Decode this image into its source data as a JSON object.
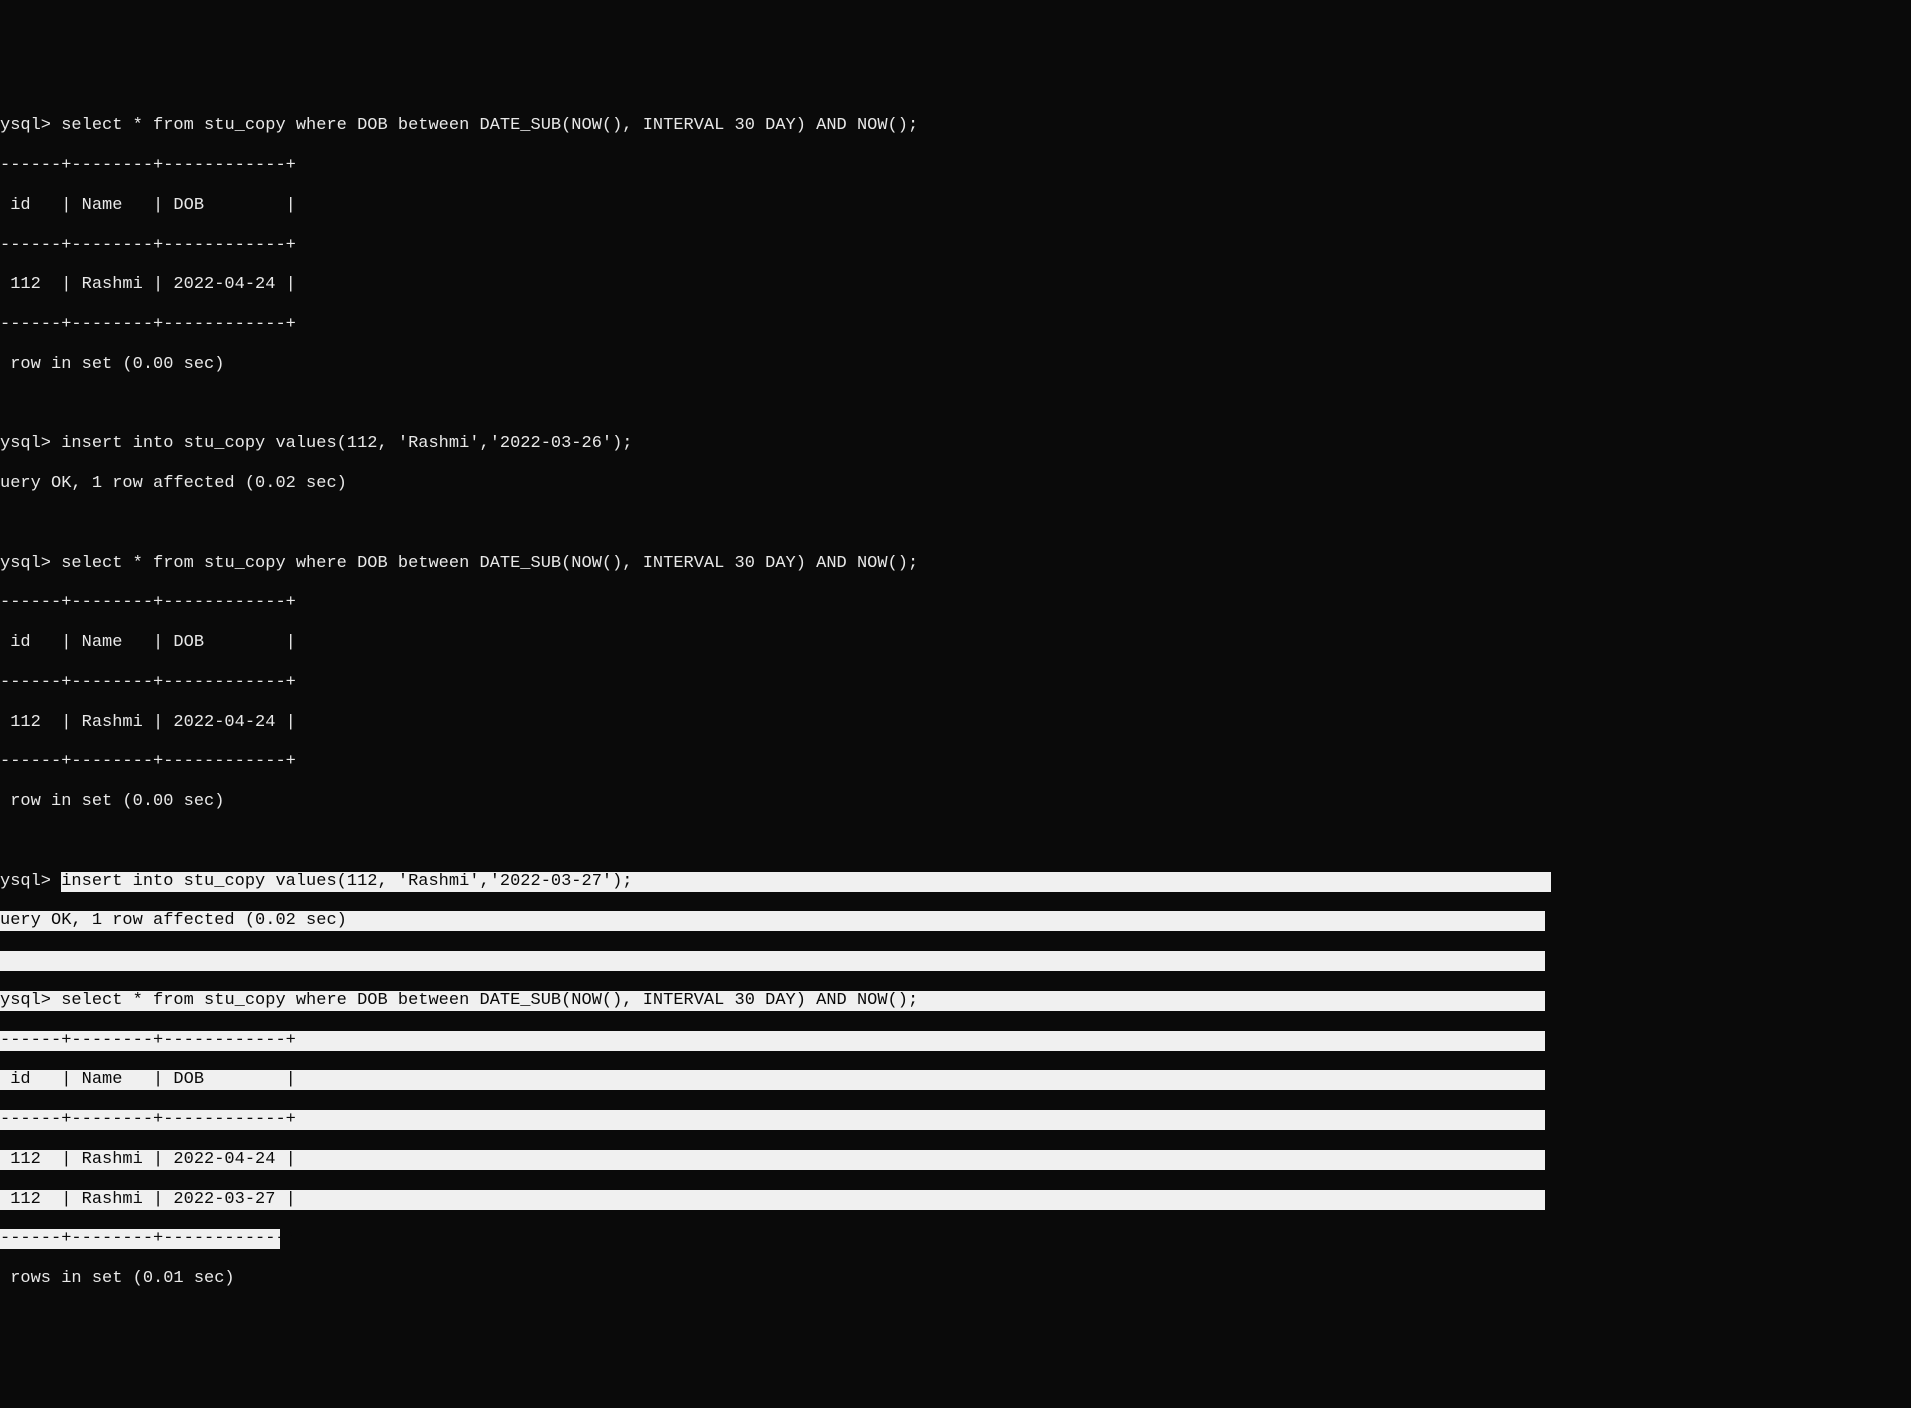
{
  "block1": {
    "prompt": "ysql> ",
    "query": "select * from stu_copy where DOB between DATE_SUB(NOW(), INTERVAL 30 DAY) AND NOW();",
    "border": "------+--------+------------+",
    "header": " id   | Name   | DOB        |",
    "row1": " 112  | Rashmi | 2022-04-24 |",
    "footer": " row in set (0.00 sec)"
  },
  "block2": {
    "prompt": "ysql> ",
    "query": "insert into stu_copy values(112, 'Rashmi','2022-03-26');",
    "result": "uery OK, 1 row affected (0.02 sec)"
  },
  "block3": {
    "prompt": "ysql> ",
    "query": "select * from stu_copy where DOB between DATE_SUB(NOW(), INTERVAL 30 DAY) AND NOW();",
    "border": "------+--------+------------+",
    "header": " id   | Name   | DOB        |",
    "row1": " 112  | Rashmi | 2022-04-24 |",
    "footer": " row in set (0.00 sec)"
  },
  "block4": {
    "prompt": "ysql> ",
    "query": "insert into stu_copy values(112, 'Rashmi','2022-03-27');",
    "result": "uery OK, 1 row affected (0.02 sec)"
  },
  "block5": {
    "prompt": "ysql> ",
    "query": "select * from stu_copy where DOB between DATE_SUB(NOW(), INTERVAL 30 DAY) AND NOW();",
    "border": "------+--------+------------+",
    "header": " id   | Name   | DOB        |",
    "row1": " 112  | Rashmi | 2022-04-24 |",
    "row2": " 112  | Rashmi | 2022-03-27 |",
    "footer": " rows in set (0.01 sec)"
  },
  "chart_data": {
    "type": "table",
    "title": "MySQL query results - stu_copy table",
    "queries": [
      {
        "sql": "select * from stu_copy where DOB between DATE_SUB(NOW(), INTERVAL 30 DAY) AND NOW();",
        "columns": [
          "id",
          "Name",
          "DOB"
        ],
        "rows": [
          {
            "id": 112,
            "Name": "Rashmi",
            "DOB": "2022-04-24"
          }
        ],
        "status": "1 row in set (0.00 sec)"
      },
      {
        "sql": "insert into stu_copy values(112, 'Rashmi','2022-03-26');",
        "status": "Query OK, 1 row affected (0.02 sec)"
      },
      {
        "sql": "select * from stu_copy where DOB between DATE_SUB(NOW(), INTERVAL 30 DAY) AND NOW();",
        "columns": [
          "id",
          "Name",
          "DOB"
        ],
        "rows": [
          {
            "id": 112,
            "Name": "Rashmi",
            "DOB": "2022-04-24"
          }
        ],
        "status": "1 row in set (0.00 sec)"
      },
      {
        "sql": "insert into stu_copy values(112, 'Rashmi','2022-03-27');",
        "status": "Query OK, 1 row affected (0.02 sec)"
      },
      {
        "sql": "select * from stu_copy where DOB between DATE_SUB(NOW(), INTERVAL 30 DAY) AND NOW();",
        "columns": [
          "id",
          "Name",
          "DOB"
        ],
        "rows": [
          {
            "id": 112,
            "Name": "Rashmi",
            "DOB": "2022-04-24"
          },
          {
            "id": 112,
            "Name": "Rashmi",
            "DOB": "2022-03-27"
          }
        ],
        "status": "2 rows in set (0.01 sec)"
      }
    ]
  }
}
